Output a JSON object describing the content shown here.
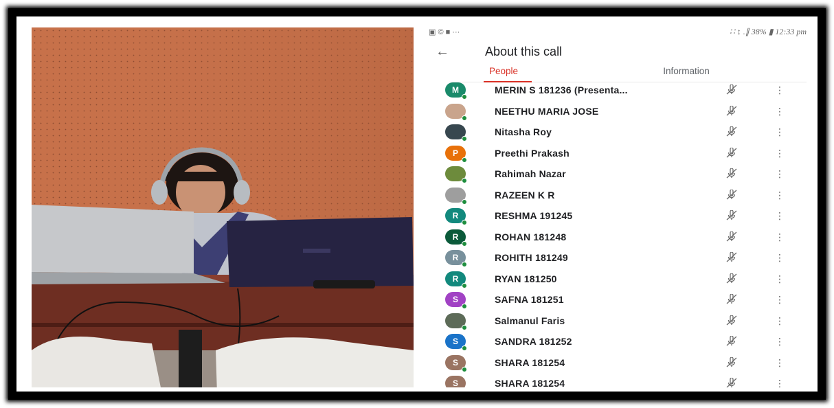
{
  "status_bar": {
    "left_icons": [
      "gallery-icon",
      "whatsapp-icon",
      "flipboard-icon",
      "overflow-dots-icon"
    ],
    "left_text": "▣ © ■ ···",
    "right_text": "∷ ↕ .∥ 38% ▮ 12:33 pm"
  },
  "appbar": {
    "back_icon": "arrow-left-icon",
    "title": "About this call"
  },
  "tabs": [
    {
      "label": "People",
      "active": true
    },
    {
      "label": "Information",
      "active": false
    }
  ],
  "accent_color": "#d93025",
  "participants": [
    {
      "name": "MERIN S 181236 (Presenta...",
      "initial": "M",
      "color": "#1a8a6a",
      "photo": false
    },
    {
      "name": "NEETHU MARIA JOSE",
      "initial": "",
      "color": "#c9a48c",
      "photo": true
    },
    {
      "name": "Nitasha Roy",
      "initial": "",
      "color": "#37474f",
      "photo": true
    },
    {
      "name": "Preethi Prakash",
      "initial": "P",
      "color": "#e8710a",
      "photo": false
    },
    {
      "name": "Rahimah Nazar",
      "initial": "",
      "color": "#6d8b3c",
      "photo": true
    },
    {
      "name": "RAZEEN K R",
      "initial": "",
      "color": "#9e9e9e",
      "photo": true
    },
    {
      "name": "RESHMA 191245",
      "initial": "R",
      "color": "#12897d",
      "photo": false
    },
    {
      "name": "ROHAN 181248",
      "initial": "R",
      "color": "#0b5a3a",
      "photo": false
    },
    {
      "name": "ROHITH 181249",
      "initial": "R",
      "color": "#78909c",
      "photo": false
    },
    {
      "name": "RYAN 181250",
      "initial": "R",
      "color": "#12897d",
      "photo": false
    },
    {
      "name": "SAFNA 181251",
      "initial": "S",
      "color": "#a142c4",
      "photo": false
    },
    {
      "name": "Salmanul Faris",
      "initial": "",
      "color": "#5d6b58",
      "photo": true
    },
    {
      "name": "SANDRA 181252",
      "initial": "S",
      "color": "#1a73c8",
      "photo": false
    },
    {
      "name": "SHARA 181254",
      "initial": "S",
      "color": "#9a7462",
      "photo": false
    },
    {
      "name": "SHARA 181254",
      "initial": "S",
      "color": "#9a7462",
      "photo": false
    }
  ],
  "row_actions": {
    "mute_icon": "mic-off-icon",
    "more_icon": "more-vert-icon"
  }
}
